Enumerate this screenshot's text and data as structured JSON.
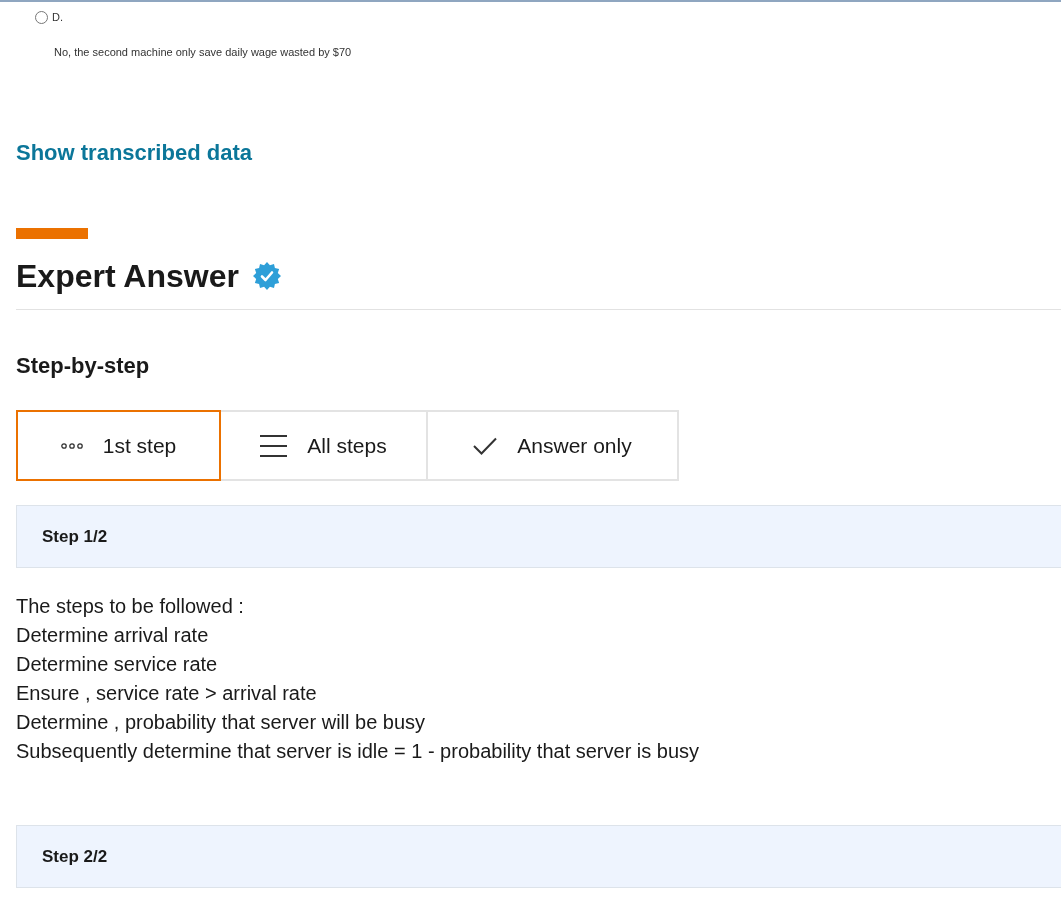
{
  "question_option": {
    "label": "D.",
    "selected": false,
    "text": "No, the second machine only save daily wage wasted by $70"
  },
  "transcribed_link": "Show transcribed data",
  "expert_answer": {
    "title": "Expert Answer",
    "verified": true
  },
  "step_by_step": {
    "title": "Step-by-step",
    "view_tabs": [
      {
        "kind": "first_step",
        "label": "1st step",
        "selected": true
      },
      {
        "kind": "all_steps",
        "label": "All steps",
        "selected": false
      },
      {
        "kind": "answer_only",
        "label": "Answer only",
        "selected": false
      }
    ]
  },
  "steps": [
    {
      "title": "Step 1/2",
      "lines": [
        "The steps to be followed :",
        "Determine arrival rate",
        "Determine service rate",
        "Ensure , service rate > arrival rate",
        "Determine , probability that server will be busy",
        "Subsequently determine that server is idle = 1 - probability that server is busy"
      ]
    },
    {
      "title": "Step 2/2"
    }
  ]
}
